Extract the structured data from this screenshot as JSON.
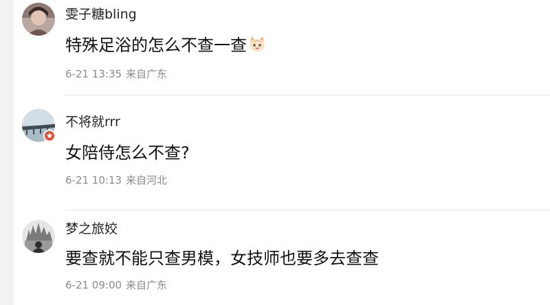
{
  "comments": [
    {
      "username": "雯子糖bling",
      "text": "特殊足浴的怎么不查一查",
      "emoji": "cat-face-icon",
      "time": "6-21 13:35",
      "location": "来自广东"
    },
    {
      "username": "不将就rrr",
      "text": "女陪侍怎么不查?",
      "time": "6-21 10:13",
      "location": "来自河北",
      "badge": "verified-badge-icon"
    },
    {
      "username": "梦之旅姣",
      "text": "要查就不能只查男模，女技师也要多去查查",
      "time": "6-21 09:00",
      "location": "来自广东"
    }
  ],
  "colors": {
    "username": "#222222",
    "text": "#111111",
    "meta": "#8a8a8a",
    "divider": "#e6e6e6",
    "badge": "#e84a2b",
    "gutter": "#f2f2f2"
  }
}
